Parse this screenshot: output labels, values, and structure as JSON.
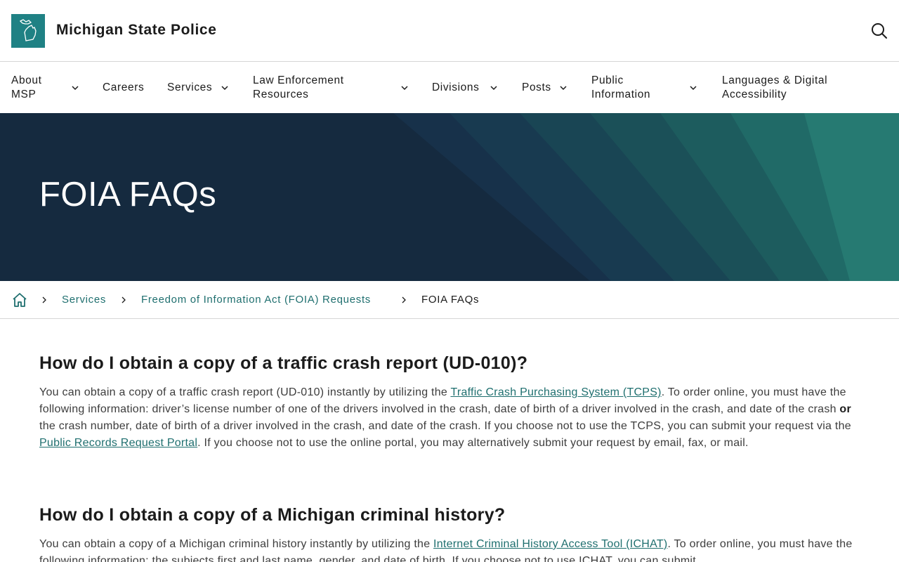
{
  "header": {
    "site_title": "Michigan State Police",
    "search_icon": "search-icon",
    "logo_icon": "michigan-map-icon"
  },
  "nav": {
    "items": [
      {
        "label_line1": "About",
        "label_line2": "MSP",
        "has_dropdown": true
      },
      {
        "label_line1": "Careers",
        "label_line2": "",
        "has_dropdown": false
      },
      {
        "label_line1": "Services",
        "label_line2": "",
        "has_dropdown": true
      },
      {
        "label_line1": "Law Enforcement",
        "label_line2": "Resources",
        "has_dropdown": true
      },
      {
        "label_line1": "Divisions",
        "label_line2": "",
        "has_dropdown": true
      },
      {
        "label_line1": "Posts",
        "label_line2": "",
        "has_dropdown": true
      },
      {
        "label_line1": "Public",
        "label_line2": "Information",
        "has_dropdown": true
      },
      {
        "label_line1": "Languages & Digital",
        "label_line2": "Accessibility",
        "has_dropdown": false
      }
    ]
  },
  "hero": {
    "title": "FOIA FAQs"
  },
  "breadcrumb": {
    "home_icon": "home-icon",
    "items": [
      "Services",
      "Freedom of Information Act (FOIA) Requests"
    ],
    "current": "FOIA FAQs"
  },
  "faqs": [
    {
      "question": "How do I obtain a copy of a traffic crash report (UD-010)?",
      "p1": "You can obtain a copy of a traffic crash report (UD-010) instantly by utilizing the ",
      "link1": "Traffic Crash Purchasing System (TCPS)",
      "p2": ". To order online, you must have the following information: driver’s license number of one of the drivers involved in the crash, date of birth of a driver involved in the crash, and date of the crash ",
      "bold": "or",
      "p3": " the crash number, date of birth of a driver involved in the crash, and date of the crash. If you choose not to use the TCPS, you can submit your request via the ",
      "link2": "Public Records Request Portal",
      "p4": ". If you choose not to use the online portal, you may alternatively submit your request by email, fax, or mail."
    },
    {
      "question": "How do I obtain a copy of a Michigan criminal history?",
      "p1": "You can obtain a copy of a Michigan criminal history instantly by utilizing the ",
      "link1": "Internet Criminal History Access Tool (ICHAT)",
      "p2": ". To order online, you must have the following information: the subjects first and last name, gender, and date of birth. If you choose not to use ICHAT, you can submit"
    }
  ],
  "colors": {
    "brand_teal": "#1f8184",
    "link": "#1f6f6f",
    "hero_navy": "#152a3f"
  }
}
